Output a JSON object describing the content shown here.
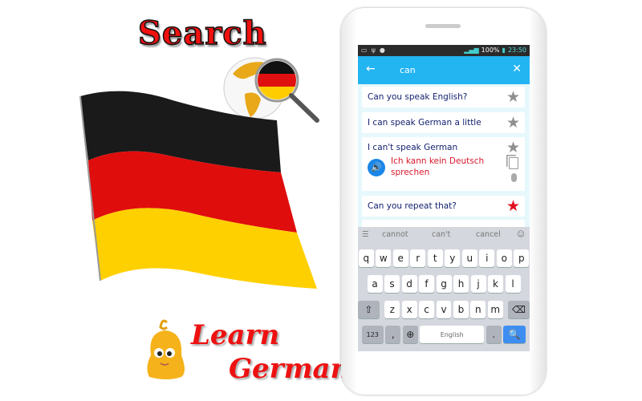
{
  "promo": {
    "title_top": "Search",
    "title_learn": "Learn",
    "title_german": "German"
  },
  "status_bar": {
    "battery": "100%",
    "time": "23:50"
  },
  "app_bar": {
    "query": "can",
    "back_icon": "arrow-left-icon",
    "clear_icon": "close-icon"
  },
  "results": [
    {
      "english": "Can you speak English?",
      "favorite": false
    },
    {
      "english": "I can speak German a little",
      "favorite": false
    },
    {
      "english": "I can't speak German",
      "german": "Ich kann kein Deutsch sprechen",
      "favorite": false,
      "expanded": true
    },
    {
      "english": "Can you repeat that?",
      "favorite": true
    }
  ],
  "keyboard": {
    "suggestions": [
      "cannot",
      "can't",
      "cancel"
    ],
    "row1": [
      "q",
      "w",
      "e",
      "r",
      "t",
      "y",
      "u",
      "i",
      "o",
      "p"
    ],
    "row2": [
      "a",
      "s",
      "d",
      "f",
      "g",
      "h",
      "j",
      "k",
      "l"
    ],
    "row3": [
      "z",
      "x",
      "c",
      "v",
      "b",
      "n",
      "m"
    ],
    "numbers_key": "123",
    "comma_key": ",",
    "space_label": "English",
    "period_key": "."
  },
  "colors": {
    "app_bar": "#23b4f2",
    "english_text": "#14216e",
    "german_text": "#d8182a",
    "favorite_star": "#e0101e",
    "promo_red": "#f01010"
  }
}
